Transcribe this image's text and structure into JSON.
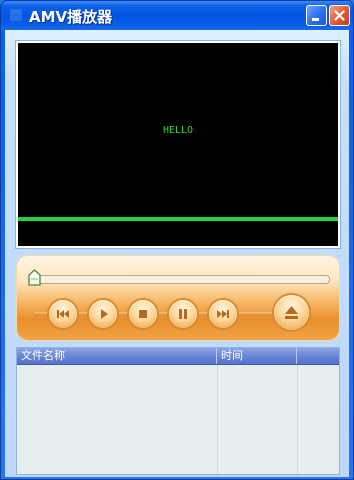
{
  "window": {
    "title": "AMV播放器",
    "controls": {
      "minimize_icon": "minimize-icon",
      "close_icon": "close-icon"
    }
  },
  "video": {
    "overlay_text": "HELLO",
    "line_color": "#27d33a",
    "background_color": "#000000"
  },
  "player": {
    "progress": 0,
    "buttons": [
      {
        "name": "previous",
        "icon": "previous-icon"
      },
      {
        "name": "play",
        "icon": "play-icon"
      },
      {
        "name": "stop",
        "icon": "stop-icon"
      },
      {
        "name": "pause",
        "icon": "pause-icon"
      },
      {
        "name": "next",
        "icon": "next-icon"
      },
      {
        "name": "eject",
        "icon": "eject-icon"
      }
    ],
    "accent_color": "#e98e2c"
  },
  "playlist": {
    "columns": [
      "文件名称",
      "时间",
      ""
    ],
    "rows": []
  }
}
